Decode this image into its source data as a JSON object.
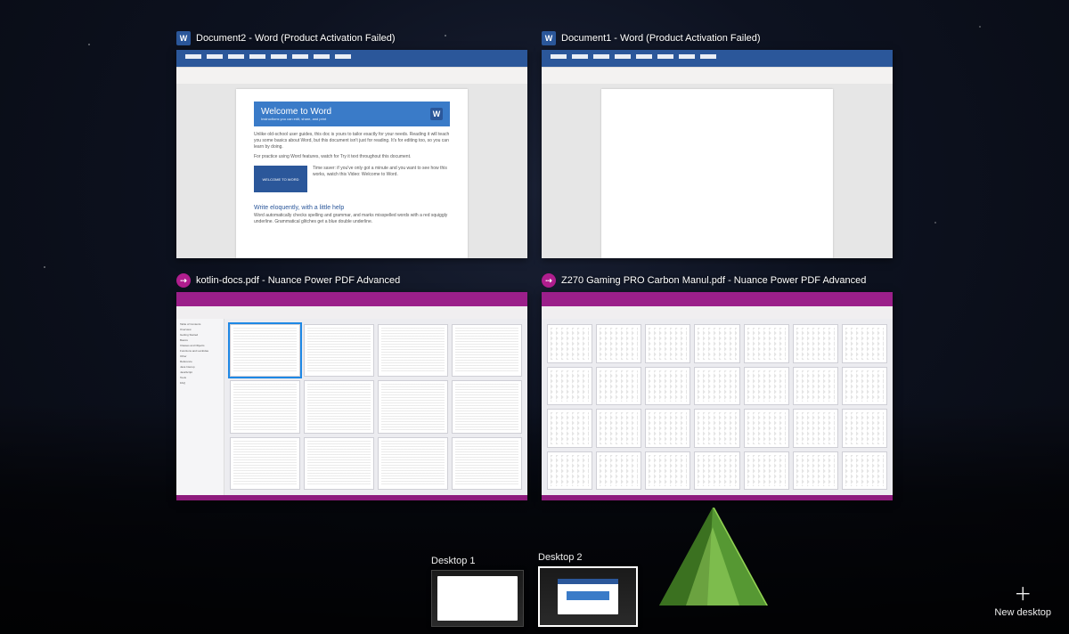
{
  "windows": [
    {
      "app": "word",
      "title": "Document2 - Word (Product Activation Failed)",
      "content": {
        "banner_title": "Welcome to Word",
        "banner_sub": "Instructions you can edit, share, and print",
        "video_caption": "WELCOME TO WORD",
        "eloquent_heading": "Write eloquently, with a little help"
      }
    },
    {
      "app": "word",
      "title": "Document1 - Word (Product Activation Failed)",
      "content": {
        "blank": true
      }
    },
    {
      "app": "pdf",
      "title": "kotlin-docs.pdf - Nuance Power PDF Advanced",
      "content": {
        "sidebar_items": [
          "Table of Contents",
          "Overview",
          "Getting Started",
          "Basics",
          "Classes and Objects",
          "Functions and Lambdas",
          "Other",
          "Reference",
          "Java Interop",
          "JavaScript",
          "Tools",
          "FAQ"
        ],
        "page_grid": "3x4"
      }
    },
    {
      "app": "pdf",
      "title": "Z270 Gaming PRO Carbon Manul.pdf - Nuance Power PDF Advanced",
      "content": {
        "page_grid": "4x7"
      }
    }
  ],
  "virtual_desktops": [
    {
      "label": "Desktop 1",
      "selected": false
    },
    {
      "label": "Desktop 2",
      "selected": true
    }
  ],
  "new_desktop_label": "New desktop"
}
